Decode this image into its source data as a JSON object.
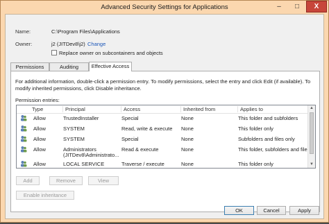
{
  "window": {
    "title": "Advanced Security Settings for Applications",
    "caption_buttons": {
      "minimize": "–",
      "maximize": "□",
      "close": "X"
    }
  },
  "details": {
    "name_label": "Name:",
    "name_value": "C:\\Program Files\\Applications",
    "owner_label": "Owner:",
    "owner_value": "j2 (JITDev8\\j2)",
    "change_link": "Change",
    "replace_owner_checkbox": {
      "label": "Replace owner on subcontainers and objects",
      "checked": false
    }
  },
  "tabs": [
    {
      "label": "Permissions",
      "active": false
    },
    {
      "label": "Auditing",
      "active": false
    },
    {
      "label": "Effective Access",
      "active": true
    }
  ],
  "panel": {
    "info_line1": "For additional information, double-click a permission entry. To modify permissions, select the entry and click Edit (if available). To",
    "info_line2": "modify inherited permissions, click Disable inheritance.",
    "entries_label": "Permission entries:",
    "columns": [
      "Type",
      "Principal",
      "Access",
      "Inherited from",
      "Applies to"
    ],
    "rows": [
      {
        "type": "Allow",
        "principal": "TrustedInstaller",
        "principal2": "",
        "access": "Special",
        "inherited": "None",
        "applies": "This folder and subfolders"
      },
      {
        "type": "Allow",
        "principal": "SYSTEM",
        "principal2": "",
        "access": "Read, write & execute",
        "inherited": "None",
        "applies": "This folder only"
      },
      {
        "type": "Allow",
        "principal": "SYSTEM",
        "principal2": "",
        "access": "Special",
        "inherited": "None",
        "applies": "Subfolders and files only"
      },
      {
        "type": "Allow",
        "principal": "Administrators",
        "principal2": "(JITDev8\\Administrato...",
        "access": "Read & execute",
        "inherited": "None",
        "applies": "This folder, subfolders and files"
      },
      {
        "type": "Allow",
        "principal": "LOCAL SERVICE",
        "principal2": "",
        "access": "Traverse / execute",
        "inherited": "None",
        "applies": "This folder only"
      }
    ],
    "buttons": {
      "add": "Add",
      "remove": "Remove",
      "view": "View"
    },
    "enable_inheritance": "Enable inheritance"
  },
  "footer": {
    "ok": "OK",
    "cancel": "Cancel",
    "apply": "Apply"
  },
  "colors": {
    "frame": "#fbd7af",
    "close_button": "#c7463a",
    "link": "#1a56b8"
  },
  "icons": {
    "principal": "user-group-icon"
  }
}
